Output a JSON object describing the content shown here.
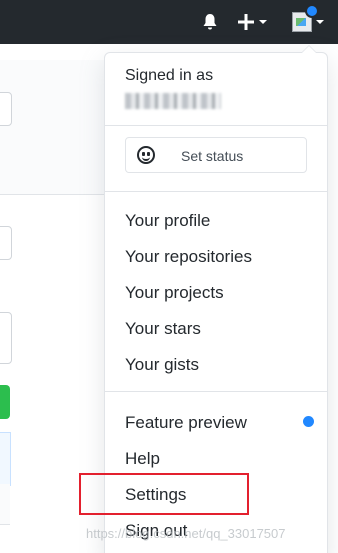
{
  "header": {
    "bell_icon": "bell-icon",
    "plus_icon": "plus-icon",
    "avatar_icon": "broken-image-avatar-icon"
  },
  "dropdown": {
    "signed_in_label": "Signed in as",
    "set_status_label": "Set status",
    "items_group1": [
      "Your profile",
      "Your repositories",
      "Your projects",
      "Your stars",
      "Your gists"
    ],
    "items_group2": [
      "Feature preview",
      "Help",
      "Settings",
      "Sign out"
    ]
  },
  "colors": {
    "header_bg": "#24292e",
    "notification_blue": "#2188ff",
    "highlight_red": "#e3202e"
  },
  "watermark": "https://blog.csdn.net/qq_33017507"
}
